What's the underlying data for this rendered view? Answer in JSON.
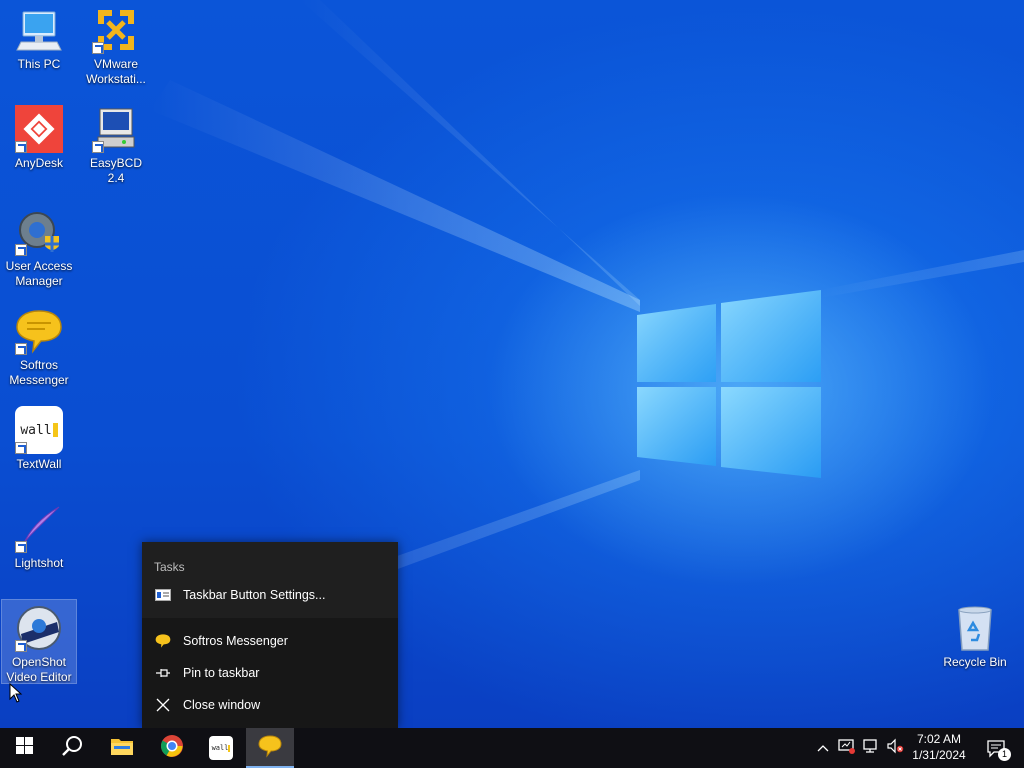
{
  "desktop": {
    "icons": [
      {
        "label": "This PC",
        "icon": "this-pc-icon"
      },
      {
        "label": "VMware Workstati...",
        "icon": "vmware-icon"
      },
      {
        "label": "AnyDesk",
        "icon": "anydesk-icon"
      },
      {
        "label": "EasyBCD 2.4",
        "icon": "easybcd-icon"
      },
      {
        "label": "User Access Manager",
        "icon": "user-access-manager-icon"
      },
      {
        "label": "Softros Messenger",
        "icon": "softros-messenger-icon"
      },
      {
        "label": "TextWall",
        "icon": "textwall-icon"
      },
      {
        "label": "Lightshot",
        "icon": "lightshot-icon"
      },
      {
        "label": "OpenShot Video Editor",
        "icon": "openshot-icon"
      },
      {
        "label": "Recycle Bin",
        "icon": "recycle-bin-icon"
      }
    ],
    "textwall_logo_text": "wall"
  },
  "jumplist": {
    "header": "Tasks",
    "items": [
      {
        "label": "Taskbar Button Settings...",
        "icon": "settings-panel-icon"
      },
      {
        "label": "Softros Messenger",
        "icon": "softros-messenger-icon"
      },
      {
        "label": "Pin to taskbar",
        "icon": "pin-icon"
      },
      {
        "label": "Close window",
        "icon": "close-icon"
      }
    ]
  },
  "taskbar": {
    "buttons": [
      {
        "name": "start",
        "icon": "windows-logo-icon"
      },
      {
        "name": "search",
        "icon": "search-icon"
      },
      {
        "name": "file-explorer",
        "icon": "folder-icon"
      },
      {
        "name": "chrome",
        "icon": "chrome-icon"
      },
      {
        "name": "textwall",
        "icon": "textwall-icon",
        "text": "wall"
      },
      {
        "name": "softros-messenger",
        "icon": "softros-messenger-icon",
        "active": true
      }
    ],
    "tray": {
      "icons": [
        "chevron-up-icon",
        "network-alert-icon",
        "network-icon",
        "volume-muted-icon"
      ],
      "time": "7:02 AM",
      "date": "1/31/2024",
      "notification_count": "1"
    }
  },
  "colors": {
    "desktop_blue": "#0a4fd0",
    "taskbar": "#0f0f14",
    "menu_bg": "#1f1f1f",
    "accent": "#7fb2f0"
  }
}
